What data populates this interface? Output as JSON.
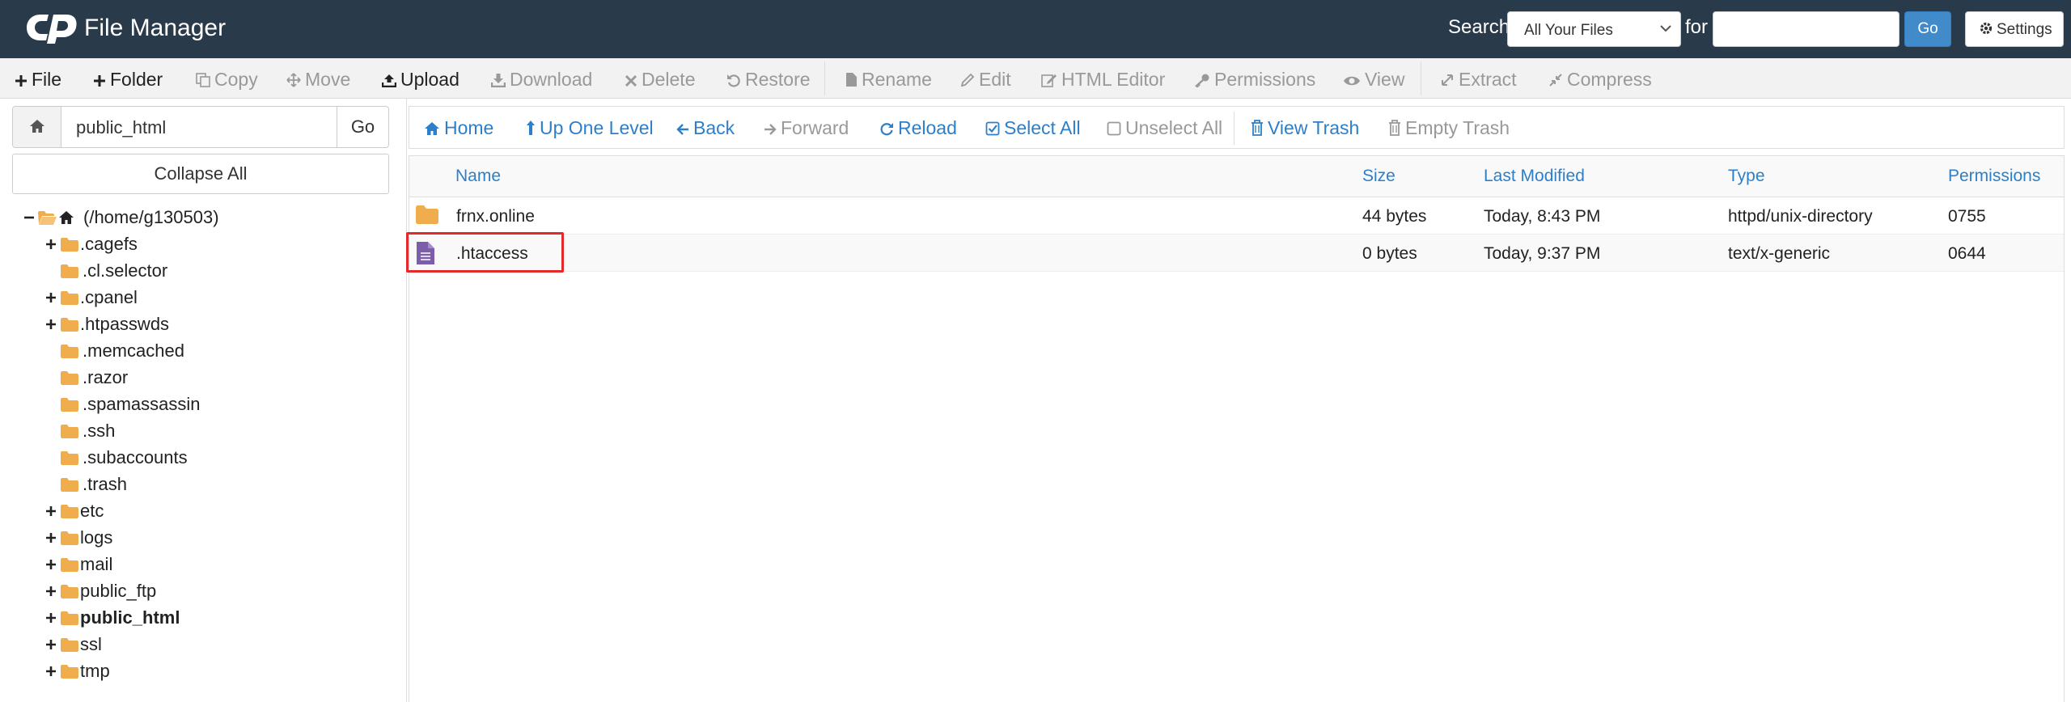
{
  "header": {
    "title": "File Manager",
    "search_label": "Search",
    "search_scope": "All Your Files",
    "for_label": "for",
    "search_value": "",
    "go_label": "Go",
    "settings_label": "Settings"
  },
  "toolbar": [
    {
      "label": "File",
      "icon": "plus-icon",
      "enabled": true
    },
    {
      "label": "Folder",
      "icon": "plus-icon",
      "enabled": true
    },
    {
      "label": "Copy",
      "icon": "copy-icon",
      "enabled": false
    },
    {
      "label": "Move",
      "icon": "move-icon",
      "enabled": false
    },
    {
      "label": "Upload",
      "icon": "upload-icon",
      "enabled": true
    },
    {
      "label": "Download",
      "icon": "download-icon",
      "enabled": false
    },
    {
      "label": "Delete",
      "icon": "times-icon",
      "enabled": false
    },
    {
      "label": "Restore",
      "icon": "undo-icon",
      "enabled": false
    },
    {
      "label": "Rename",
      "icon": "file-icon",
      "enabled": false
    },
    {
      "label": "Edit",
      "icon": "pencil-icon",
      "enabled": false
    },
    {
      "label": "HTML Editor",
      "icon": "edit-icon",
      "enabled": false
    },
    {
      "label": "Permissions",
      "icon": "key-icon",
      "enabled": false
    },
    {
      "label": "View",
      "icon": "eye-icon",
      "enabled": false
    },
    {
      "label": "Extract",
      "icon": "expand-icon",
      "enabled": false
    },
    {
      "label": "Compress",
      "icon": "compress-icon",
      "enabled": false
    }
  ],
  "left": {
    "path_value": "public_html",
    "go_label": "Go",
    "collapse_label": "Collapse All",
    "tree": [
      {
        "label": "(/home/g130503)",
        "toggle": "minus",
        "open": true,
        "home": true
      },
      {
        "label": ".cagefs",
        "toggle": "plus"
      },
      {
        "label": ".cl.selector",
        "toggle": ""
      },
      {
        "label": ".cpanel",
        "toggle": "plus"
      },
      {
        "label": ".htpasswds",
        "toggle": "plus"
      },
      {
        "label": ".memcached",
        "toggle": ""
      },
      {
        "label": ".razor",
        "toggle": ""
      },
      {
        "label": ".spamassassin",
        "toggle": ""
      },
      {
        "label": ".ssh",
        "toggle": ""
      },
      {
        "label": ".subaccounts",
        "toggle": ""
      },
      {
        "label": ".trash",
        "toggle": ""
      },
      {
        "label": "etc",
        "toggle": "plus"
      },
      {
        "label": "logs",
        "toggle": "plus"
      },
      {
        "label": "mail",
        "toggle": "plus"
      },
      {
        "label": "public_ftp",
        "toggle": "plus"
      },
      {
        "label": "public_html",
        "toggle": "plus",
        "bold": true
      },
      {
        "label": "ssl",
        "toggle": "plus"
      },
      {
        "label": "tmp",
        "toggle": "plus"
      }
    ]
  },
  "nav": [
    {
      "label": "Home",
      "icon": "home-icon",
      "enabled": true
    },
    {
      "label": "Up One Level",
      "icon": "level-up-icon",
      "enabled": true
    },
    {
      "label": "Back",
      "icon": "arrow-left-icon",
      "enabled": true
    },
    {
      "label": "Forward",
      "icon": "arrow-right-icon",
      "enabled": false
    },
    {
      "label": "Reload",
      "icon": "refresh-icon",
      "enabled": true
    },
    {
      "label": "Select All",
      "icon": "check-square-icon",
      "enabled": true
    },
    {
      "label": "Unselect All",
      "icon": "square-icon",
      "enabled": false
    },
    {
      "label": "View Trash",
      "icon": "trash-icon",
      "enabled": true
    },
    {
      "label": "Empty Trash",
      "icon": "trash-icon",
      "enabled": false
    }
  ],
  "table": {
    "columns": [
      "Name",
      "Size",
      "Last Modified",
      "Type",
      "Permissions"
    ],
    "rows": [
      {
        "icon": "folder-icon",
        "name": "frnx.online",
        "size": "44 bytes",
        "modified": "Today, 8:43 PM",
        "type": "httpd/unix-directory",
        "perms": "0755"
      },
      {
        "icon": "text-file-icon",
        "name": ".htaccess",
        "size": "0 bytes",
        "modified": "Today, 9:37 PM",
        "type": "text/x-generic",
        "perms": "0644",
        "highlighted": true
      }
    ]
  },
  "colors": {
    "header_bg": "#293a4a",
    "link": "#2c7fc8",
    "folder": "#f0ad4e",
    "file": "#7b5ea7",
    "highlight": "#e22a2a"
  }
}
